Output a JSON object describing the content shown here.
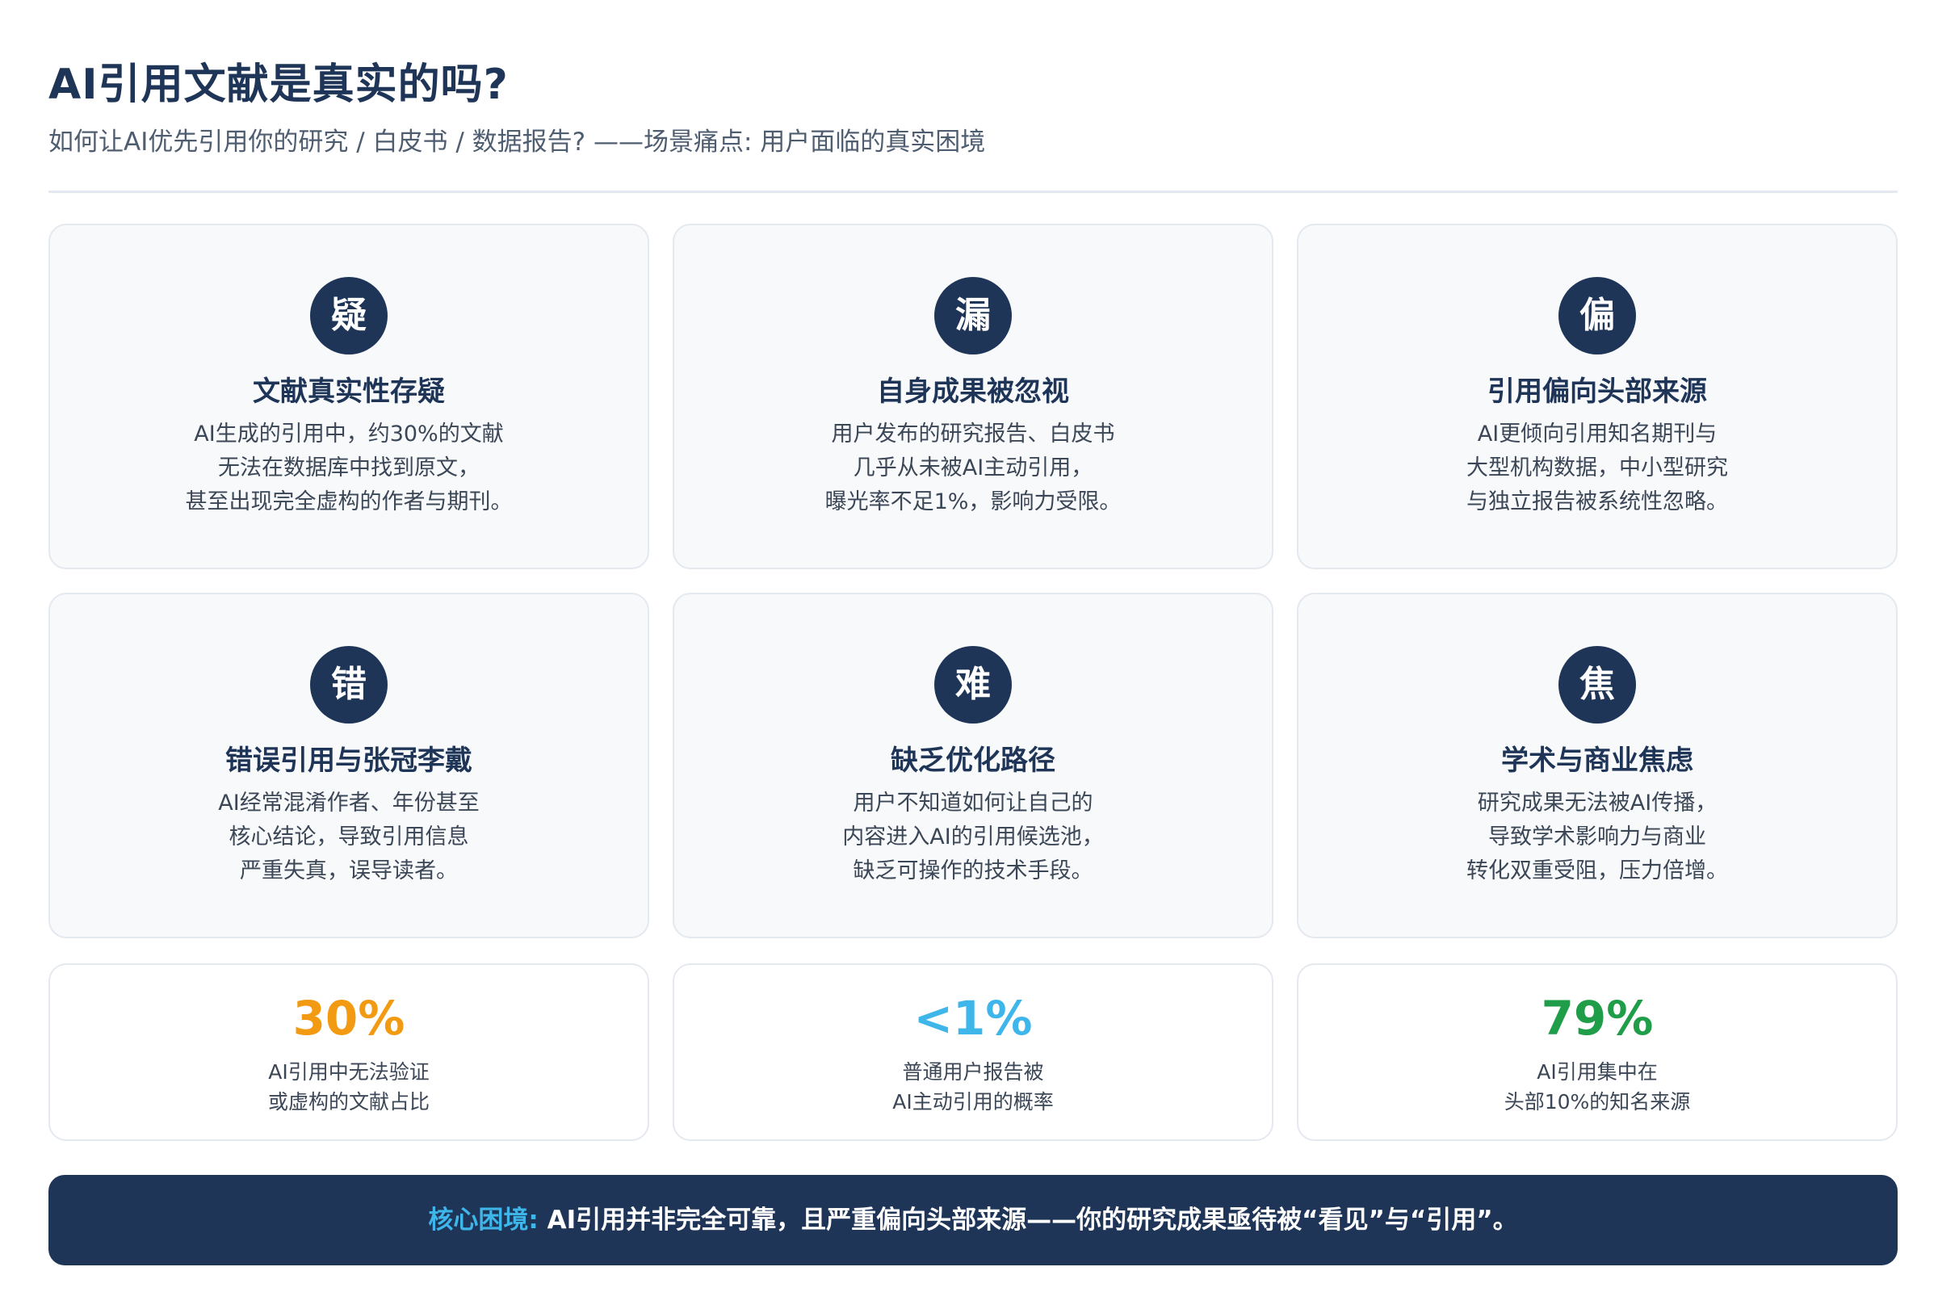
{
  "header": {
    "title": "AI引用文献是真实的吗?",
    "subtitle": "如何让AI优先引用你的研究 / 白皮书 / 数据报告? ——场景痛点: 用户面临的真实困境"
  },
  "cards": [
    {
      "badge": "疑",
      "title": "文献真实性存疑",
      "lines": [
        "AI生成的引用中，约30%的文献",
        "无法在数据库中找到原文，",
        "甚至出现完全虚构的作者与期刊。"
      ]
    },
    {
      "badge": "漏",
      "title": "自身成果被忽视",
      "lines": [
        "用户发布的研究报告、白皮书",
        "几乎从未被AI主动引用，",
        "曝光率不足1%，影响力受限。"
      ]
    },
    {
      "badge": "偏",
      "title": "引用偏向头部来源",
      "lines": [
        "AI更倾向引用知名期刊与",
        "大型机构数据，中小型研究",
        "与独立报告被系统性忽略。"
      ]
    },
    {
      "badge": "错",
      "title": "错误引用与张冠李戴",
      "lines": [
        "AI经常混淆作者、年份甚至",
        "核心结论，导致引用信息",
        "严重失真，误导读者。"
      ]
    },
    {
      "badge": "难",
      "title": "缺乏优化路径",
      "lines": [
        "用户不知道如何让自己的",
        "内容进入AI的引用候选池，",
        "缺乏可操作的技术手段。"
      ]
    },
    {
      "badge": "焦",
      "title": "学术与商业焦虑",
      "lines": [
        "研究成果无法被AI传播，",
        "导致学术影响力与商业",
        "转化双重受阻，压力倍增。"
      ]
    }
  ],
  "stats": [
    {
      "value": "30%",
      "color": "#f29a12",
      "lines": [
        "AI引用中无法验证",
        "或虚构的文献占比"
      ]
    },
    {
      "value": "<1%",
      "color": "#3fb6ea",
      "lines": [
        "普通用户报告被",
        "AI主动引用的概率"
      ]
    },
    {
      "value": "79%",
      "color": "#1f9d48",
      "lines": [
        "AI引用集中在",
        "头部10%的知名来源"
      ]
    }
  ],
  "banner": {
    "highlight": "核心困境:",
    "text": " AI引用并非完全可靠，且严重偏向头部来源——你的研究成果亟待被“看见”与“引用”。"
  }
}
